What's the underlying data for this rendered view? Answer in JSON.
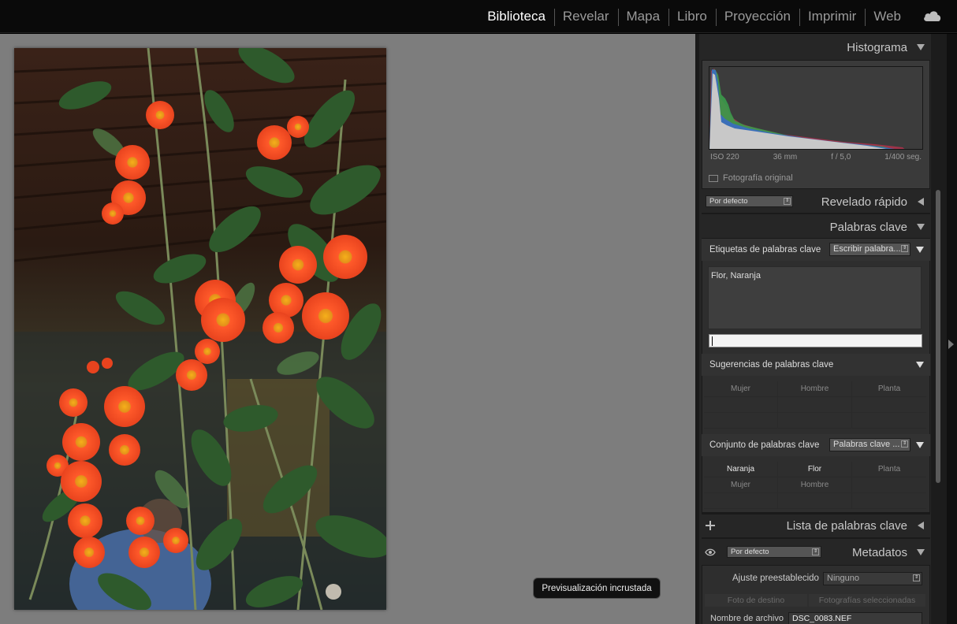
{
  "modules": [
    "Biblioteca",
    "Revelar",
    "Mapa",
    "Libro",
    "Proyección",
    "Imprimir",
    "Web"
  ],
  "active_module": "Biblioteca",
  "viewer": {
    "toast": "Previsualización incrustada"
  },
  "histogram": {
    "title": "Histograma",
    "iso": "ISO 220",
    "focal": "36 mm",
    "aperture": "f / 5,0",
    "shutter": "1/400 seg.",
    "original_label": "Fotografía original"
  },
  "quick_develop": {
    "preset": "Por defecto",
    "title": "Revelado rápido"
  },
  "keywords": {
    "title": "Palabras clave",
    "tags_label": "Etiquetas de palabras clave",
    "tags_mode": "Escribir palabra...",
    "tags_value": "Flor, Naranja",
    "suggestions_label": "Sugerencias de palabras clave",
    "suggestions": [
      "Mujer",
      "Hombre",
      "Planta",
      "",
      "",
      "",
      "",
      "",
      ""
    ],
    "set_label": "Conjunto de palabras clave",
    "set_mode": "Palabras clave ...",
    "set_items": [
      "Naranja",
      "Flor",
      "Planta",
      "Mujer",
      "Hombre",
      "",
      "",
      "",
      ""
    ]
  },
  "keyword_list": {
    "title": "Lista de palabras clave"
  },
  "metadata": {
    "title": "Metadatos",
    "preset": "Por defecto",
    "preset_label": "Ajuste preestablecido",
    "preset_value": "Ninguno",
    "target_photo": "Foto de destino",
    "selected_photos": "Fotografías seleccionadas",
    "filename_label": "Nombre de archivo",
    "filename": "DSC_0083.NEF"
  },
  "colors": {
    "background": "#000000",
    "viewer": "#7d7d7d",
    "panel": "#262626",
    "active_text": "#ffffff"
  }
}
